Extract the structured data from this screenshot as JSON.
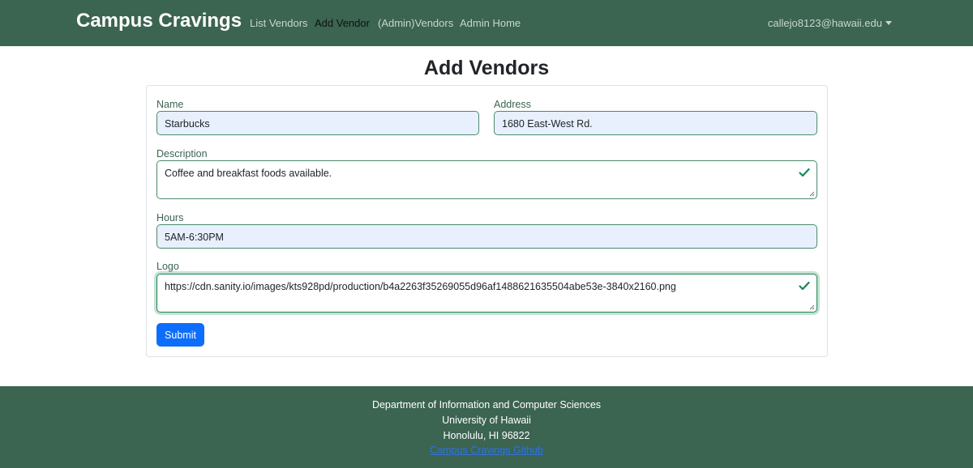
{
  "navbar": {
    "brand": "Campus Cravings",
    "links": [
      {
        "label": "List Vendors"
      },
      {
        "label": "Add Vendor"
      },
      {
        "label": "(Admin)Vendors"
      },
      {
        "label": "Admin Home"
      }
    ],
    "active_link": "Add Vendor",
    "user_email": "callejo8123@hawaii.edu"
  },
  "page": {
    "title": "Add Vendors"
  },
  "form": {
    "name": {
      "label": "Name",
      "value": "Starbucks"
    },
    "address": {
      "label": "Address",
      "value": "1680 East-West Rd."
    },
    "description": {
      "label": "Description",
      "value": "Coffee and breakfast foods available."
    },
    "hours": {
      "label": "Hours",
      "value": "5AM-6:30PM"
    },
    "logo": {
      "label": "Logo",
      "value": "https://cdn.sanity.io/images/kts928pd/production/b4a2263f35269055d96af1488621635504abe53e-3840x2160.png"
    },
    "submit_label": "Submit"
  },
  "footer": {
    "line1": "Department of Information and Computer Sciences",
    "line2": "University of Hawaii",
    "line3": "Honolulu, HI 96822",
    "link": "Campus Cravings Github"
  },
  "colors": {
    "navbar_bg": "#3b6451",
    "footer_bg": "#3b6451",
    "primary_button": "#0d6efd",
    "valid_green": "#198754",
    "autofill_bg": "#e8f0fe"
  },
  "icons": {
    "valid": "check-icon",
    "user_menu": "caret-down-icon"
  }
}
